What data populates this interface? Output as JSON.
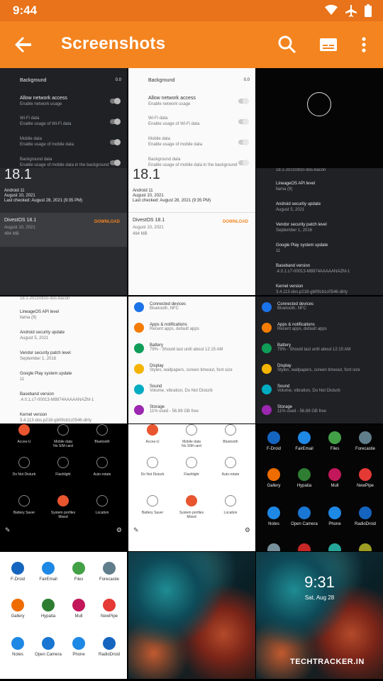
{
  "status": {
    "time": "9:44"
  },
  "appbar": {
    "title": "Screenshots"
  },
  "t1": {
    "bg": "Background",
    "bgv": "0.0",
    "net": "Allow network access",
    "net_s": "Enable network usage",
    "wifi": "Wi-Fi data",
    "wifi_s": "Enable usage of Wi-Fi data",
    "mob": "Mobile data",
    "mob_s": "Enable usage of mobile data",
    "bgd": "Background data",
    "bgd_s": "Enable usage of mobile data in the background"
  },
  "t2": {
    "ver": "18.1",
    "a": "Android 11",
    "d": "August 10, 2021",
    "lc": "Last checked: August 28, 2021 (9:35 PM)",
    "name": "DivestOS 18.1",
    "date": "August 10, 2021",
    "size": "494 MB",
    "dl": "DOWNLOAD"
  },
  "t3": {
    "build": "18.1-20210810-dos-bacon",
    "api": "LineageOS API level",
    "api_v": "llama (9)",
    "sec": "Android security update",
    "sec_v": "August 5, 2021",
    "ven": "Vendor security patch level",
    "ven_v": "September 1, 2016",
    "gp": "Google Play system update",
    "gp_v": "11",
    "bb": "Baseband version",
    "bb_v": ".4.0.1.c7-00013-M8974AAAAANAZM-1",
    "k": "Kernel version",
    "k_v": "3.4.113-dos.p218-gb09cb1c0546-dirty"
  },
  "settings": [
    {
      "t": "Connected devices",
      "s": "Bluetooth, NFC",
      "c": "#1a73e8"
    },
    {
      "t": "Apps & notifications",
      "s": "Recent apps, default apps",
      "c": "#f57c00"
    },
    {
      "t": "Battery",
      "s": "79% - Should last until about 12:15 AM",
      "c": "#0f9d58"
    },
    {
      "t": "Display",
      "s": "Styles, wallpapers, screen timeout, font size",
      "c": "#f4b400"
    },
    {
      "t": "Sound",
      "s": "Volume, vibration, Do Not Disturb",
      "c": "#00acc1"
    },
    {
      "t": "Storage",
      "s": "11% used - 56.89 GB free",
      "c": "#9c27b0"
    }
  ],
  "qs": [
    {
      "l": "Acces-U",
      "s": ""
    },
    {
      "l": "Mobile data",
      "s": "No SIM card"
    },
    {
      "l": "Bluetooth",
      "s": ""
    },
    {
      "l": "Do Not Disturb",
      "s": ""
    },
    {
      "l": "Flashlight",
      "s": ""
    },
    {
      "l": "Auto-rotate",
      "s": ""
    },
    {
      "l": "Battery Saver",
      "s": ""
    },
    {
      "l": "System profiles",
      "s": "Mixed"
    },
    {
      "l": "Location",
      "s": ""
    }
  ],
  "apps": [
    {
      "l": "F-Droid",
      "c": "#1565c0"
    },
    {
      "l": "FairEmail",
      "c": "#1e88e5"
    },
    {
      "l": "Files",
      "c": "#43a047"
    },
    {
      "l": "Forecastie",
      "c": "#607d8b"
    },
    {
      "l": "Gallery",
      "c": "#ef6c00"
    },
    {
      "l": "Hypatia",
      "c": "#2e7d32"
    },
    {
      "l": "Mull",
      "c": "#c2185b"
    },
    {
      "l": "NewPipe",
      "c": "#e53935"
    },
    {
      "l": "Notes",
      "c": "#1e88e5"
    },
    {
      "l": "Open Camera",
      "c": "#1976d2"
    },
    {
      "l": "Phone",
      "c": "#1e88e5"
    },
    {
      "l": "RadioDroid",
      "c": "#1565c0"
    }
  ],
  "lock": {
    "time": "9:31",
    "date": "Sat, Aug 28"
  },
  "watermark": "TECHTRACKER.IN"
}
